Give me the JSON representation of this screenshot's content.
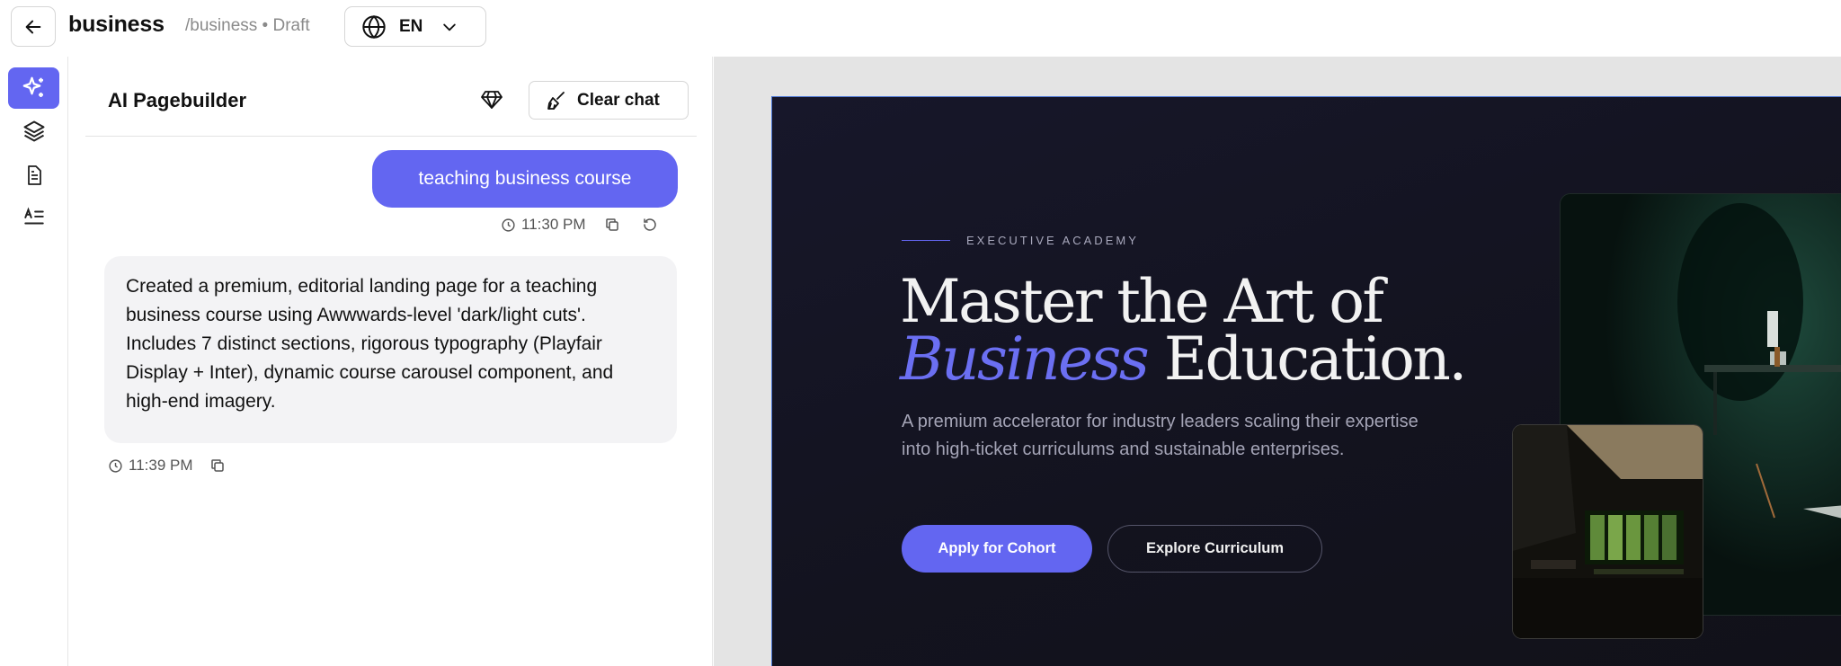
{
  "topbar": {
    "title": "business",
    "path": "/business • Draft",
    "language": "EN"
  },
  "rail": {
    "items": [
      {
        "icon": "sparkles-icon",
        "active": true
      },
      {
        "icon": "layers-icon",
        "active": false
      },
      {
        "icon": "document-icon",
        "active": false
      },
      {
        "icon": "text-align-icon",
        "active": false
      }
    ]
  },
  "chat": {
    "title": "AI Pagebuilder",
    "clear_label": "Clear chat",
    "messages": [
      {
        "role": "user",
        "text": "teaching business course",
        "time": "11:30 PM"
      },
      {
        "role": "assistant",
        "text": "Created a premium, editorial landing page for a teaching business course using Awwwards-level 'dark/light cuts'. Includes 7 distinct sections, rigorous typography (Playfair Display + Inter), dynamic course carousel component, and high-end imagery.",
        "time": "11:39 PM"
      }
    ]
  },
  "preview": {
    "kicker": "EXECUTIVE ACADEMY",
    "headline_line1": "Master the Art of",
    "headline_accent": "Business",
    "headline_rest": " Education.",
    "subtitle": "A premium accelerator for industry leaders scaling their expertise into high-ticket curriculums and sustainable enterprises.",
    "primary_cta": "Apply for Cohort",
    "secondary_cta": "Explore Curriculum"
  },
  "colors": {
    "accent": "#6366f1",
    "hero_bg": "#15151f"
  }
}
